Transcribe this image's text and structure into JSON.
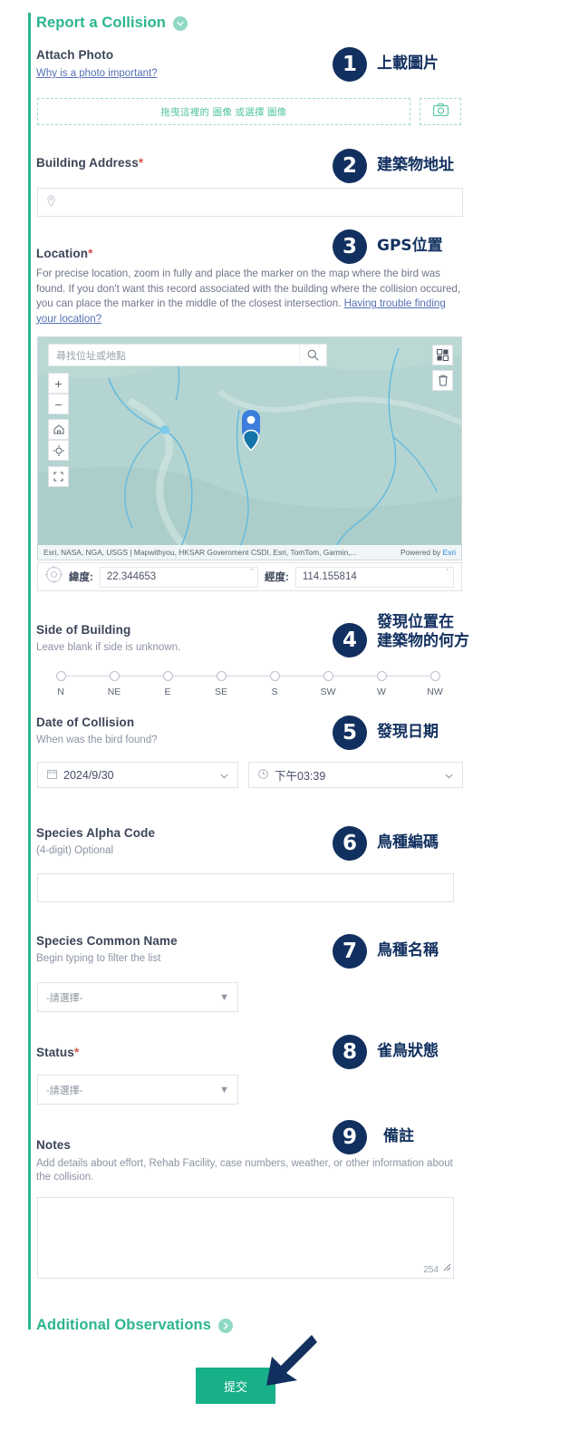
{
  "section": {
    "title": "Report a Collision",
    "collapse_icon": "chevron-down-icon"
  },
  "photo": {
    "label": "Attach Photo",
    "link": "Why is a photo important?",
    "dropzone_text": "拖曳這裡的 圖像 或選擇 圖像",
    "camera_icon": "camera-icon"
  },
  "address": {
    "label": "Building Address",
    "required_mark": "*",
    "value": "",
    "pin_icon": "map-pin-icon"
  },
  "location": {
    "label": "Location",
    "required_mark": "*",
    "description_1": "For precise location, zoom in fully and place the marker on the map where the bird was found.",
    "description_2": "If you don't want this record associated with the building where the collision occured, you can",
    "description_3": "place the marker in the middle of the closest intersection.",
    "help_link": "Having trouble finding your location?",
    "map": {
      "search_placeholder": "尋找位址或地點",
      "search_icon": "search-icon",
      "zoom_in": "+",
      "zoom_out": "−",
      "home_icon": "home-icon",
      "locate_icon": "locate-icon",
      "fullscreen_icon": "fullscreen-icon",
      "basemap_icon": "basemap-gallery-icon",
      "delete_icon": "trash-icon",
      "attribution": "Esri, NASA, NGA, USGS | Mapwithyou, HKSAR Government CSDI, Esri, TomTom, Garmin,...",
      "powered_by": "Powered by",
      "powered_by_link": "Esri",
      "marker_icon": "map-marker-icon"
    },
    "lat_label": "緯度:",
    "lat_value": "22.344653",
    "lon_label": "經度:",
    "lon_value": "114.155814",
    "degree_symbol": "°",
    "target_icon": "crosshair-icon"
  },
  "side": {
    "label": "Side of Building",
    "hint": "Leave blank if side is unknown.",
    "options": [
      "N",
      "NE",
      "E",
      "SE",
      "S",
      "SW",
      "W",
      "NW"
    ]
  },
  "date": {
    "label": "Date of Collision",
    "hint": "When was the bird found?",
    "date_value": "2024/9/30",
    "time_value": "下午03:39",
    "calendar_icon": "calendar-icon",
    "clock_icon": "clock-icon",
    "chevron": "chevron-down-icon"
  },
  "alpha_code": {
    "label": "Species Alpha Code",
    "hint": "(4-digit) Optional",
    "value": ""
  },
  "common_name": {
    "label": "Species Common Name",
    "hint": "Begin typing to filter the list",
    "selected": "-請選擇-"
  },
  "status": {
    "label": "Status",
    "required_mark": "*",
    "selected": "-請選擇-"
  },
  "notes": {
    "label": "Notes",
    "hint_1": "Add details about effort, Rehab Facility, case numbers, weather, or other information about the",
    "hint_2": "collision.",
    "value": "",
    "char_count": "254"
  },
  "additional": {
    "title": "Additional Observations",
    "expand_icon": "chevron-right-icon"
  },
  "submit": {
    "label": "提交",
    "arrow_icon": "arrow-pointer-icon"
  },
  "callouts": [
    {
      "num": "1",
      "text": "上載圖片"
    },
    {
      "num": "2",
      "text": "建築物地址"
    },
    {
      "num": "3",
      "text": "GPS位置"
    },
    {
      "num": "4",
      "text": "發現位置在\n建築物的何方"
    },
    {
      "num": "5",
      "text": "發現日期"
    },
    {
      "num": "6",
      "text": "鳥種編碼"
    },
    {
      "num": "7",
      "text": "鳥種名稱"
    },
    {
      "num": "8",
      "text": "雀鳥狀態"
    },
    {
      "num": "9",
      "text": "備註"
    }
  ],
  "colors": {
    "teal": "#2bb58f",
    "navy": "#12305f",
    "submit_green": "#17b089",
    "required_red": "#d9534f",
    "link_blue": "#5570b5"
  }
}
